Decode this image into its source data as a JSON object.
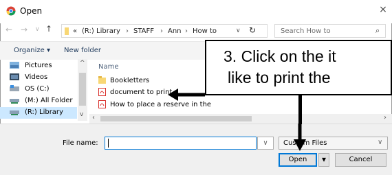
{
  "window": {
    "title": "Open",
    "close_label": "×"
  },
  "nav": {
    "back": "←",
    "forward": "→",
    "recent": "∨",
    "up": "↑",
    "crumb_more": "«",
    "breadcrumbs": [
      "(R:) Library",
      "STAFF",
      "Ann",
      "How to"
    ],
    "sep": "›",
    "dropdown": "∨",
    "refresh": "↻",
    "search_placeholder": "Search How to",
    "search_icon_glyph": "⌕"
  },
  "toolbar": {
    "organize_label": "Organize ▾",
    "new_folder_label": "New folder"
  },
  "sidebar": {
    "items": [
      {
        "label": "Pictures",
        "icon": "pictures-icon"
      },
      {
        "label": "Videos",
        "icon": "videos-icon"
      },
      {
        "label": "OS (C:)",
        "icon": "drive-icon"
      },
      {
        "label": "(M:) All Folder",
        "icon": "network-drive-icon"
      },
      {
        "label": "(R:) Library",
        "icon": "network-drive-icon",
        "selected": true
      }
    ],
    "scroll_up": "^",
    "scroll_down": "v"
  },
  "file_list": {
    "column_name": "Name",
    "files": [
      {
        "name": "Bookletters",
        "type": "folder"
      },
      {
        "name": "document to print",
        "type": "pdf"
      },
      {
        "name": "How to place a reserve in the",
        "type": "pdf"
      }
    ],
    "hscroll_left": "‹",
    "hscroll_right": "›"
  },
  "bottom": {
    "file_name_label": "File name:",
    "file_name_value": "",
    "file_name_dropdown": "∨",
    "filter_value": "Custom Files",
    "filter_chevron": "∨",
    "open_label": "Open",
    "open_split": "▾",
    "cancel_label": "Cancel"
  },
  "annotation": {
    "line1": "3. Click on the it",
    "line2": "like to print the"
  },
  "colors": {
    "accent": "#0078d7",
    "selection": "#cce8ff",
    "folder": "#f8d775",
    "pdf": "#d9302c"
  }
}
